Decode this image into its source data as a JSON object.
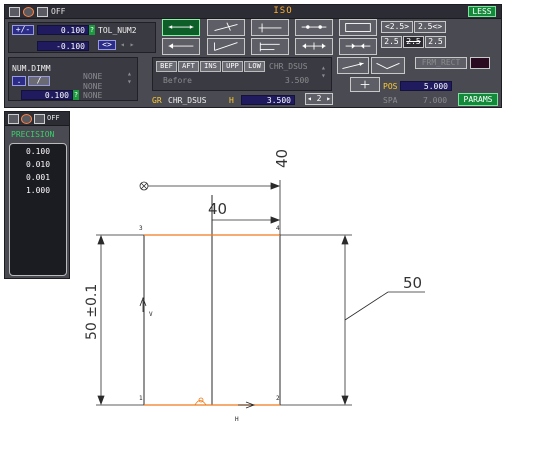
{
  "toolbar": {
    "title": "ISO",
    "less_label": "LESS",
    "off_label": "OFF",
    "tolerance": {
      "sign_toggle": "+/-",
      "upper_value": "0.100",
      "lower_value": "-0.100",
      "mode_label": "TOL_NUM2",
      "swap_label": "<>"
    },
    "num_dimm": {
      "label": "NUM.DIMM",
      "value": "0.100",
      "none_labels": [
        "NONE",
        "NONE",
        "NONE"
      ]
    },
    "text_position": {
      "tabs": [
        "BEF",
        "AFT",
        "INS",
        "UPP",
        "LOW"
      ],
      "tab_extra": "CHR_DSUS",
      "before_label": "Before",
      "before_value": "3.500"
    },
    "chr_row": {
      "gr_label": "GR",
      "chr_label": "CHR_DSUS",
      "h_label": "H",
      "h_value": "3.500",
      "counter": "2"
    },
    "frame_rect_label": "FRM_RECT",
    "pos_label": "POS",
    "pos_value": "5.000",
    "spa_label": "SPA",
    "spa_value": "7.000",
    "params_label": "PARAMS",
    "precision_buttons": [
      "<2.5>",
      "2.5<>",
      "2.5",
      "2.5",
      "2.5"
    ]
  },
  "precision_panel": {
    "title": "PRECISION",
    "off_label": "OFF",
    "items": [
      "0.100",
      "0.010",
      "0.001",
      "1.000"
    ]
  },
  "drawing": {
    "dim_top_vertical": "40",
    "dim_top_horizontal": "40",
    "dim_left": "50 ±0.1",
    "dim_right": "50",
    "corner_labels": [
      "1",
      "2",
      "3",
      "4"
    ],
    "axis_v": "V",
    "axis_h": "H"
  }
}
